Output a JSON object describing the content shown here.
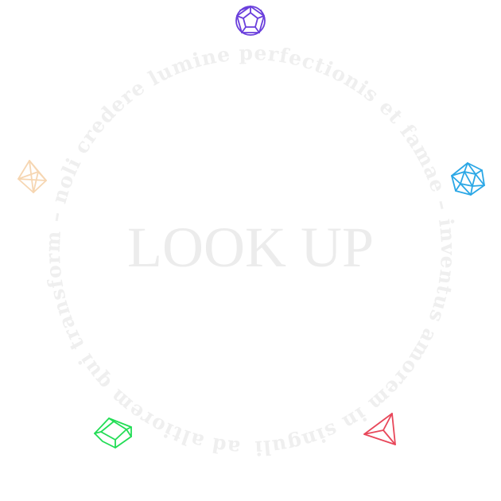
{
  "title": "LOOK UP",
  "ring_text": "– ad altiorem qui transform – noli credere lumine perfectionis et famae – inventus amorem in singulis",
  "solids": [
    {
      "name": "dodecahedron",
      "color": "#6a3fdc"
    },
    {
      "name": "icosahedron",
      "color": "#2aa7e6"
    },
    {
      "name": "tetrahedron",
      "color": "#e8475a"
    },
    {
      "name": "cube",
      "color": "#22dd55"
    },
    {
      "name": "octahedron",
      "color": "#f6d6b2"
    }
  ]
}
